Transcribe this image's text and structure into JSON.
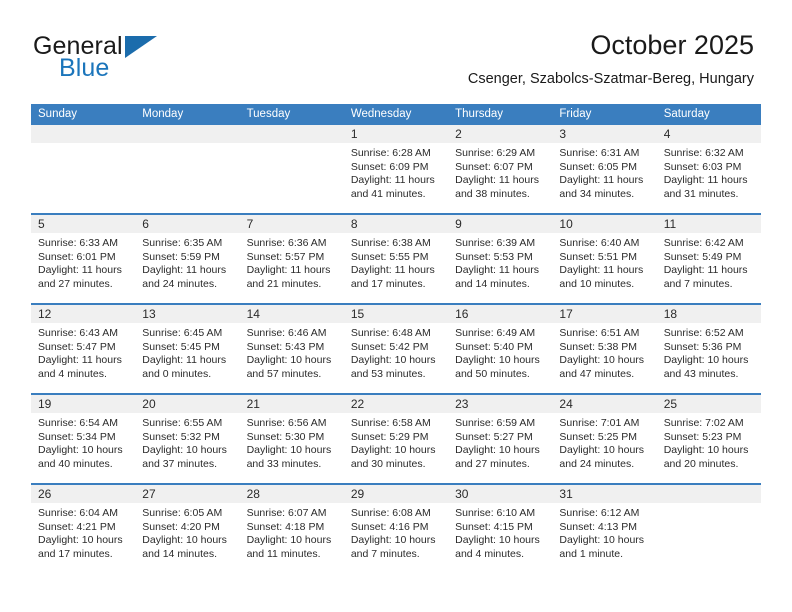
{
  "brand": {
    "general": "General",
    "blue": "Blue",
    "flag_icon": "triangle-flag-icon"
  },
  "header": {
    "title": "October 2025",
    "location": "Csenger, Szabolcs-Szatmar-Bereg, Hungary"
  },
  "colors": {
    "header_blue": "#3a7ebf",
    "brand_blue": "#1b75bb",
    "day_band": "#f0f0f0",
    "text": "#2b2b2b"
  },
  "calendar": {
    "weekdays": [
      "Sunday",
      "Monday",
      "Tuesday",
      "Wednesday",
      "Thursday",
      "Friday",
      "Saturday"
    ],
    "labels": {
      "sunrise": "Sunrise:",
      "sunset": "Sunset:",
      "daylight": "Daylight:"
    },
    "weeks": [
      [
        {
          "day": "",
          "empty": true
        },
        {
          "day": "",
          "empty": true
        },
        {
          "day": "",
          "empty": true
        },
        {
          "day": "1",
          "sunrise": "Sunrise: 6:28 AM",
          "sunset": "Sunset: 6:09 PM",
          "daylight_1": "Daylight: 11 hours",
          "daylight_2": "and 41 minutes."
        },
        {
          "day": "2",
          "sunrise": "Sunrise: 6:29 AM",
          "sunset": "Sunset: 6:07 PM",
          "daylight_1": "Daylight: 11 hours",
          "daylight_2": "and 38 minutes."
        },
        {
          "day": "3",
          "sunrise": "Sunrise: 6:31 AM",
          "sunset": "Sunset: 6:05 PM",
          "daylight_1": "Daylight: 11 hours",
          "daylight_2": "and 34 minutes."
        },
        {
          "day": "4",
          "sunrise": "Sunrise: 6:32 AM",
          "sunset": "Sunset: 6:03 PM",
          "daylight_1": "Daylight: 11 hours",
          "daylight_2": "and 31 minutes."
        }
      ],
      [
        {
          "day": "5",
          "sunrise": "Sunrise: 6:33 AM",
          "sunset": "Sunset: 6:01 PM",
          "daylight_1": "Daylight: 11 hours",
          "daylight_2": "and 27 minutes."
        },
        {
          "day": "6",
          "sunrise": "Sunrise: 6:35 AM",
          "sunset": "Sunset: 5:59 PM",
          "daylight_1": "Daylight: 11 hours",
          "daylight_2": "and 24 minutes."
        },
        {
          "day": "7",
          "sunrise": "Sunrise: 6:36 AM",
          "sunset": "Sunset: 5:57 PM",
          "daylight_1": "Daylight: 11 hours",
          "daylight_2": "and 21 minutes."
        },
        {
          "day": "8",
          "sunrise": "Sunrise: 6:38 AM",
          "sunset": "Sunset: 5:55 PM",
          "daylight_1": "Daylight: 11 hours",
          "daylight_2": "and 17 minutes."
        },
        {
          "day": "9",
          "sunrise": "Sunrise: 6:39 AM",
          "sunset": "Sunset: 5:53 PM",
          "daylight_1": "Daylight: 11 hours",
          "daylight_2": "and 14 minutes."
        },
        {
          "day": "10",
          "sunrise": "Sunrise: 6:40 AM",
          "sunset": "Sunset: 5:51 PM",
          "daylight_1": "Daylight: 11 hours",
          "daylight_2": "and 10 minutes."
        },
        {
          "day": "11",
          "sunrise": "Sunrise: 6:42 AM",
          "sunset": "Sunset: 5:49 PM",
          "daylight_1": "Daylight: 11 hours",
          "daylight_2": "and 7 minutes."
        }
      ],
      [
        {
          "day": "12",
          "sunrise": "Sunrise: 6:43 AM",
          "sunset": "Sunset: 5:47 PM",
          "daylight_1": "Daylight: 11 hours",
          "daylight_2": "and 4 minutes."
        },
        {
          "day": "13",
          "sunrise": "Sunrise: 6:45 AM",
          "sunset": "Sunset: 5:45 PM",
          "daylight_1": "Daylight: 11 hours",
          "daylight_2": "and 0 minutes."
        },
        {
          "day": "14",
          "sunrise": "Sunrise: 6:46 AM",
          "sunset": "Sunset: 5:43 PM",
          "daylight_1": "Daylight: 10 hours",
          "daylight_2": "and 57 minutes."
        },
        {
          "day": "15",
          "sunrise": "Sunrise: 6:48 AM",
          "sunset": "Sunset: 5:42 PM",
          "daylight_1": "Daylight: 10 hours",
          "daylight_2": "and 53 minutes."
        },
        {
          "day": "16",
          "sunrise": "Sunrise: 6:49 AM",
          "sunset": "Sunset: 5:40 PM",
          "daylight_1": "Daylight: 10 hours",
          "daylight_2": "and 50 minutes."
        },
        {
          "day": "17",
          "sunrise": "Sunrise: 6:51 AM",
          "sunset": "Sunset: 5:38 PM",
          "daylight_1": "Daylight: 10 hours",
          "daylight_2": "and 47 minutes."
        },
        {
          "day": "18",
          "sunrise": "Sunrise: 6:52 AM",
          "sunset": "Sunset: 5:36 PM",
          "daylight_1": "Daylight: 10 hours",
          "daylight_2": "and 43 minutes."
        }
      ],
      [
        {
          "day": "19",
          "sunrise": "Sunrise: 6:54 AM",
          "sunset": "Sunset: 5:34 PM",
          "daylight_1": "Daylight: 10 hours",
          "daylight_2": "and 40 minutes."
        },
        {
          "day": "20",
          "sunrise": "Sunrise: 6:55 AM",
          "sunset": "Sunset: 5:32 PM",
          "daylight_1": "Daylight: 10 hours",
          "daylight_2": "and 37 minutes."
        },
        {
          "day": "21",
          "sunrise": "Sunrise: 6:56 AM",
          "sunset": "Sunset: 5:30 PM",
          "daylight_1": "Daylight: 10 hours",
          "daylight_2": "and 33 minutes."
        },
        {
          "day": "22",
          "sunrise": "Sunrise: 6:58 AM",
          "sunset": "Sunset: 5:29 PM",
          "daylight_1": "Daylight: 10 hours",
          "daylight_2": "and 30 minutes."
        },
        {
          "day": "23",
          "sunrise": "Sunrise: 6:59 AM",
          "sunset": "Sunset: 5:27 PM",
          "daylight_1": "Daylight: 10 hours",
          "daylight_2": "and 27 minutes."
        },
        {
          "day": "24",
          "sunrise": "Sunrise: 7:01 AM",
          "sunset": "Sunset: 5:25 PM",
          "daylight_1": "Daylight: 10 hours",
          "daylight_2": "and 24 minutes."
        },
        {
          "day": "25",
          "sunrise": "Sunrise: 7:02 AM",
          "sunset": "Sunset: 5:23 PM",
          "daylight_1": "Daylight: 10 hours",
          "daylight_2": "and 20 minutes."
        }
      ],
      [
        {
          "day": "26",
          "sunrise": "Sunrise: 6:04 AM",
          "sunset": "Sunset: 4:21 PM",
          "daylight_1": "Daylight: 10 hours",
          "daylight_2": "and 17 minutes."
        },
        {
          "day": "27",
          "sunrise": "Sunrise: 6:05 AM",
          "sunset": "Sunset: 4:20 PM",
          "daylight_1": "Daylight: 10 hours",
          "daylight_2": "and 14 minutes."
        },
        {
          "day": "28",
          "sunrise": "Sunrise: 6:07 AM",
          "sunset": "Sunset: 4:18 PM",
          "daylight_1": "Daylight: 10 hours",
          "daylight_2": "and 11 minutes."
        },
        {
          "day": "29",
          "sunrise": "Sunrise: 6:08 AM",
          "sunset": "Sunset: 4:16 PM",
          "daylight_1": "Daylight: 10 hours",
          "daylight_2": "and 7 minutes."
        },
        {
          "day": "30",
          "sunrise": "Sunrise: 6:10 AM",
          "sunset": "Sunset: 4:15 PM",
          "daylight_1": "Daylight: 10 hours",
          "daylight_2": "and 4 minutes."
        },
        {
          "day": "31",
          "sunrise": "Sunrise: 6:12 AM",
          "sunset": "Sunset: 4:13 PM",
          "daylight_1": "Daylight: 10 hours",
          "daylight_2": "and 1 minute."
        },
        {
          "day": "",
          "empty": true
        }
      ]
    ]
  }
}
